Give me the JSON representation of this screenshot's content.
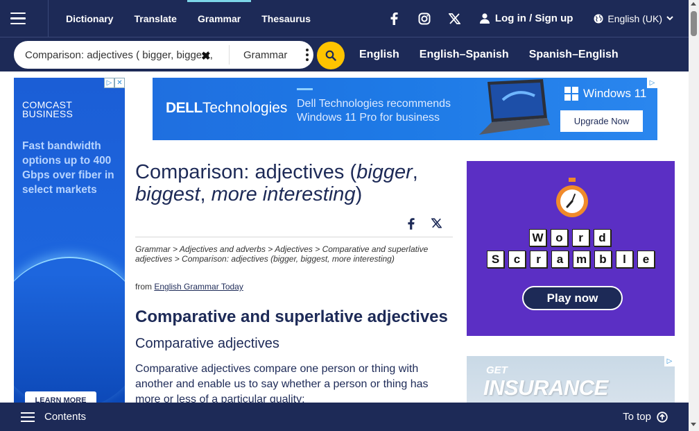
{
  "nav": {
    "links": [
      "Dictionary",
      "Translate",
      "Grammar",
      "Thesaurus"
    ],
    "active": "Grammar",
    "social_icons": [
      "facebook-icon",
      "instagram-icon",
      "x-icon"
    ],
    "login_label": "Log in / Sign up",
    "language_label": "English (UK)"
  },
  "search": {
    "value": "Comparison: adjectives ( bigger, biggest, more interesting )",
    "dictionary_label": "Grammar",
    "dict_links": [
      "English",
      "English–Spanish",
      "Spanish–English"
    ]
  },
  "ads": {
    "left": {
      "brand_line1": "COMCAST",
      "brand_line2": "BUSINESS",
      "copy": "Fast bandwidth options up to 400 Gbps over fiber in select markets",
      "button": "LEARN MORE"
    },
    "banner": {
      "brand_bold": "DELL",
      "brand_rest": "Technologies",
      "copy_line1": "Dell Technologies recommends",
      "copy_line2": "Windows 11 Pro for business",
      "product": "Windows 11",
      "button": "Upgrade Now"
    },
    "word": {
      "row1": [
        "W",
        "o",
        "r",
        "d"
      ],
      "row2": [
        "S",
        "c",
        "r",
        "a",
        "m",
        "b",
        "l",
        "e"
      ],
      "button": "Play now"
    },
    "insurance": {
      "line1": "GET",
      "line2": "INSURANCE"
    }
  },
  "article": {
    "title_prefix": "Comparison: adjectives (",
    "title_italic1": "bigger",
    "title_sep1": ", ",
    "title_italic2": "biggest",
    "title_sep2": ", ",
    "title_italic3": "more interesting",
    "title_suffix": ")",
    "breadcrumb": "Grammar > Adjectives and adverbs > Adjectives > Comparative and superlative adjectives > Comparison: adjectives (bigger, biggest, more interesting)",
    "from_label": "from",
    "from_link": "English Grammar Today",
    "h2": "Comparative and superlative adjectives",
    "h3": "Comparative adjectives",
    "paragraph": "Comparative adjectives compare one person or thing with another and enable us to say whether a person or thing has more or less of a particular quality:"
  },
  "bottom": {
    "contents_label": "Contents",
    "totop_label": "To top"
  },
  "colors": {
    "navy": "#1d2a57",
    "accent_yellow": "#fec400",
    "active_tab": "#7dd6e8",
    "word_ad_purple": "#5b2fc4"
  }
}
